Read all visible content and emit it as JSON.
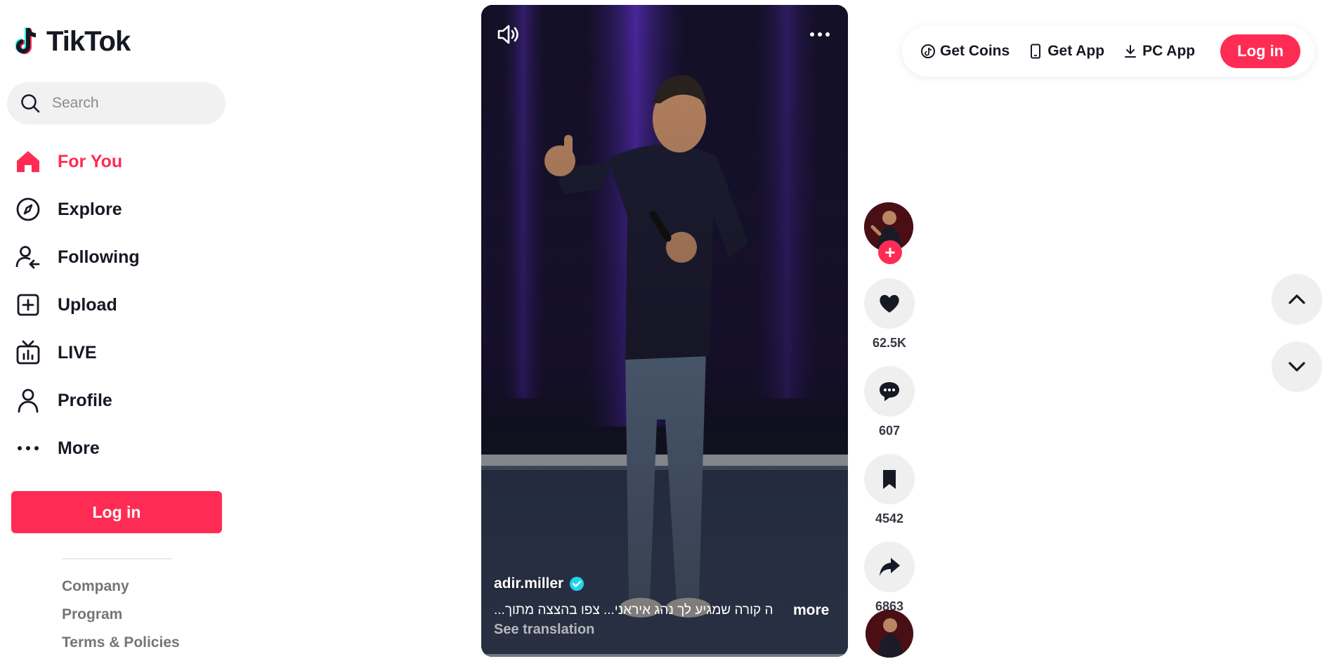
{
  "app": {
    "logo_text": "TikTok"
  },
  "search": {
    "placeholder": "Search"
  },
  "sidebar": {
    "items": [
      {
        "label": "For You",
        "icon": "home-icon",
        "active": true
      },
      {
        "label": "Explore",
        "icon": "compass-icon"
      },
      {
        "label": "Following",
        "icon": "following-icon"
      },
      {
        "label": "Upload",
        "icon": "upload-icon"
      },
      {
        "label": "LIVE",
        "icon": "live-icon"
      },
      {
        "label": "Profile",
        "icon": "profile-icon"
      },
      {
        "label": "More",
        "icon": "more-dots-icon"
      }
    ],
    "login_label": "Log in",
    "footer_links": [
      "Company",
      "Program",
      "Terms & Policies"
    ]
  },
  "video": {
    "author": "adir.miller",
    "verified": true,
    "caption": "ה קורה שמגיע לך נהג איראני... צפו בהצצה מתוך...",
    "more_label": "more",
    "see_translation": "See translation"
  },
  "actions": {
    "likes": "62.5K",
    "comments": "607",
    "saves": "4542",
    "shares": "6863"
  },
  "topbar": {
    "get_coins": "Get Coins",
    "get_app": "Get App",
    "pc_app": "PC App",
    "login_label": "Log in"
  },
  "colors": {
    "brand": "#fe2c55",
    "verified": "#20d5ec",
    "text": "#161823"
  }
}
